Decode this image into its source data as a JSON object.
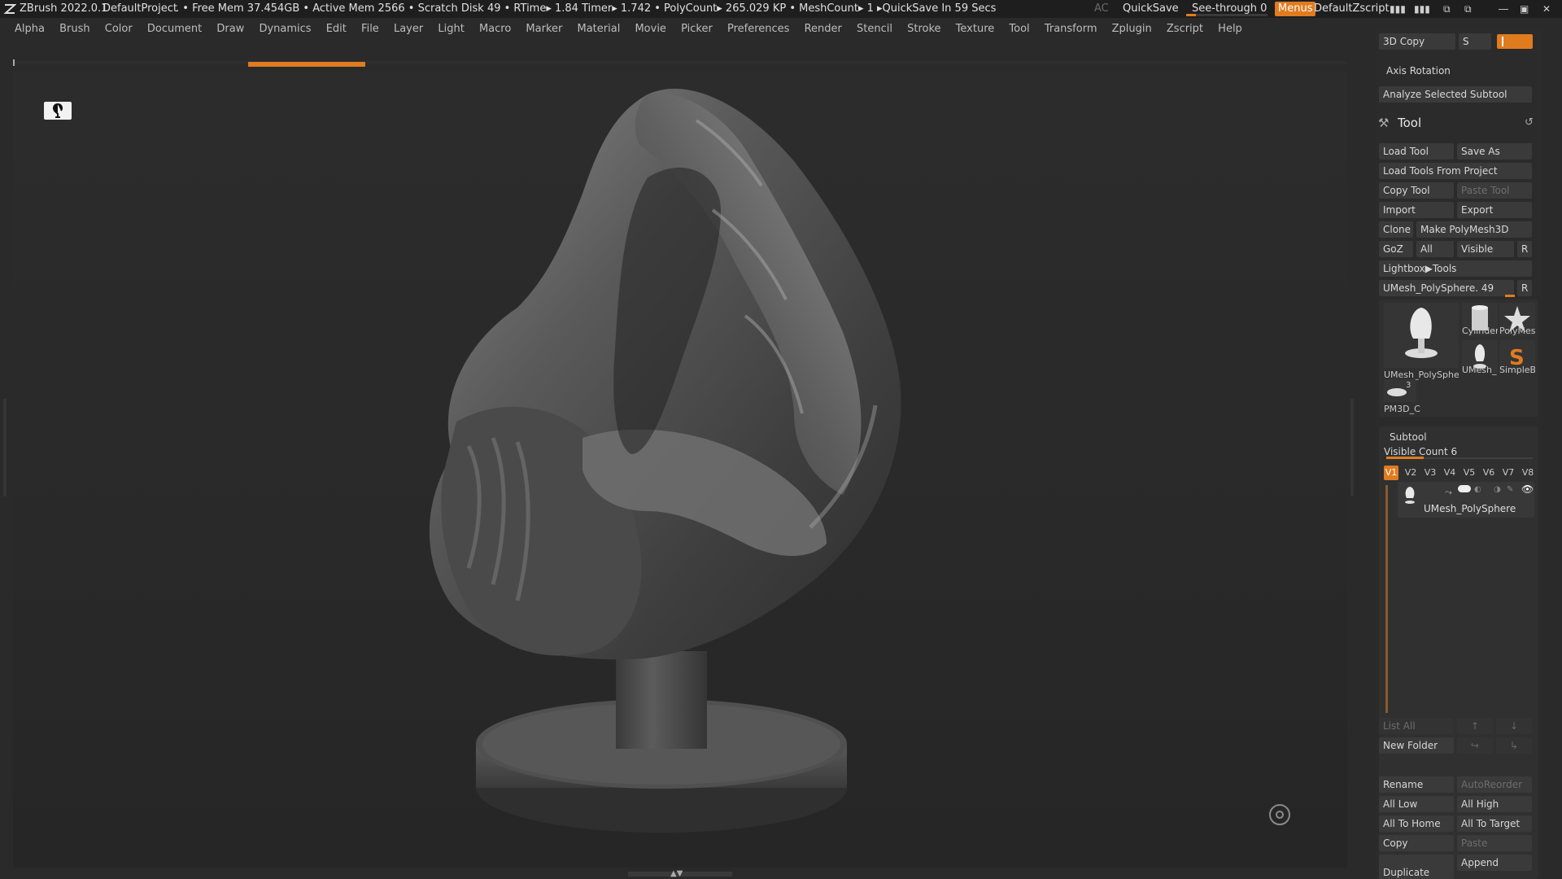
{
  "titlebar": {
    "app": "ZBrush 2022.0.1",
    "project": "DefaultProject",
    "stats": ". • Free Mem 37.454GB • Active Mem 2566 • Scratch Disk 49 •  RTime▸ 1.84 Timer▸ 1.742 • PolyCount▸ 265.029 KP  • MeshCount▸ 1   ▸QuickSave In 59 Secs",
    "ac": "AC",
    "quicksave": "QuickSave",
    "see_through": "See-through  0",
    "see_through_value": 0,
    "menus": "Menus",
    "zscript": "DefaultZscript",
    "accent": "#e07b1f"
  },
  "menubar": [
    "Alpha",
    "Brush",
    "Color",
    "Document",
    "Draw",
    "Dynamics",
    "Edit",
    "File",
    "Layer",
    "Light",
    "Macro",
    "Marker",
    "Material",
    "Movie",
    "Picker",
    "Preferences",
    "Render",
    "Stencil",
    "Stroke",
    "Texture",
    "Tool",
    "Transform",
    "Zplugin",
    "Zscript",
    "Help"
  ],
  "panel": {
    "copy3d": "3D Copy",
    "copy_s": "S",
    "axis_rotation": "Axis Rotation",
    "analyze": "Analyze Selected Subtool",
    "tool_title": "Tool",
    "load_tool": "Load Tool",
    "save_as": "Save As",
    "load_from_project": "Load Tools From Project",
    "copy_tool": "Copy Tool",
    "paste_tool": "Paste Tool",
    "import": "Import",
    "export": "Export",
    "clone": "Clone",
    "make_polymesh": "Make PolyMesh3D",
    "goz": "GoZ",
    "all": "All",
    "visible": "Visible",
    "r": "R",
    "lightbox_tools": "Lightbox▶Tools",
    "current_tool": "UMesh_PolySphere. 49",
    "current_r": "R",
    "thumbs": {
      "main": "UMesh_PolySphe",
      "cylinder": "Cylinder",
      "polymesh": "PolyMes",
      "umesh_small": "UMesh_",
      "simpleb": "SimpleB",
      "pm3d": "PM3D_C",
      "pm3d_count": "3"
    },
    "subtool_title": "Subtool",
    "visible_count": "Visible Count 6",
    "vtabs": [
      "V1",
      "V2",
      "V3",
      "V4",
      "V5",
      "V6",
      "V7",
      "V8"
    ],
    "subtool_name": "UMesh_PolySphere",
    "list_all": "List All",
    "new_folder": "New Folder",
    "rename": "Rename",
    "autoreorder": "AutoReorder",
    "all_low": "All Low",
    "all_high": "All High",
    "all_to_home": "All To Home",
    "all_to_target": "All To Target",
    "copy": "Copy",
    "paste": "Paste",
    "append": "Append",
    "duplicate": "Duplicate"
  }
}
